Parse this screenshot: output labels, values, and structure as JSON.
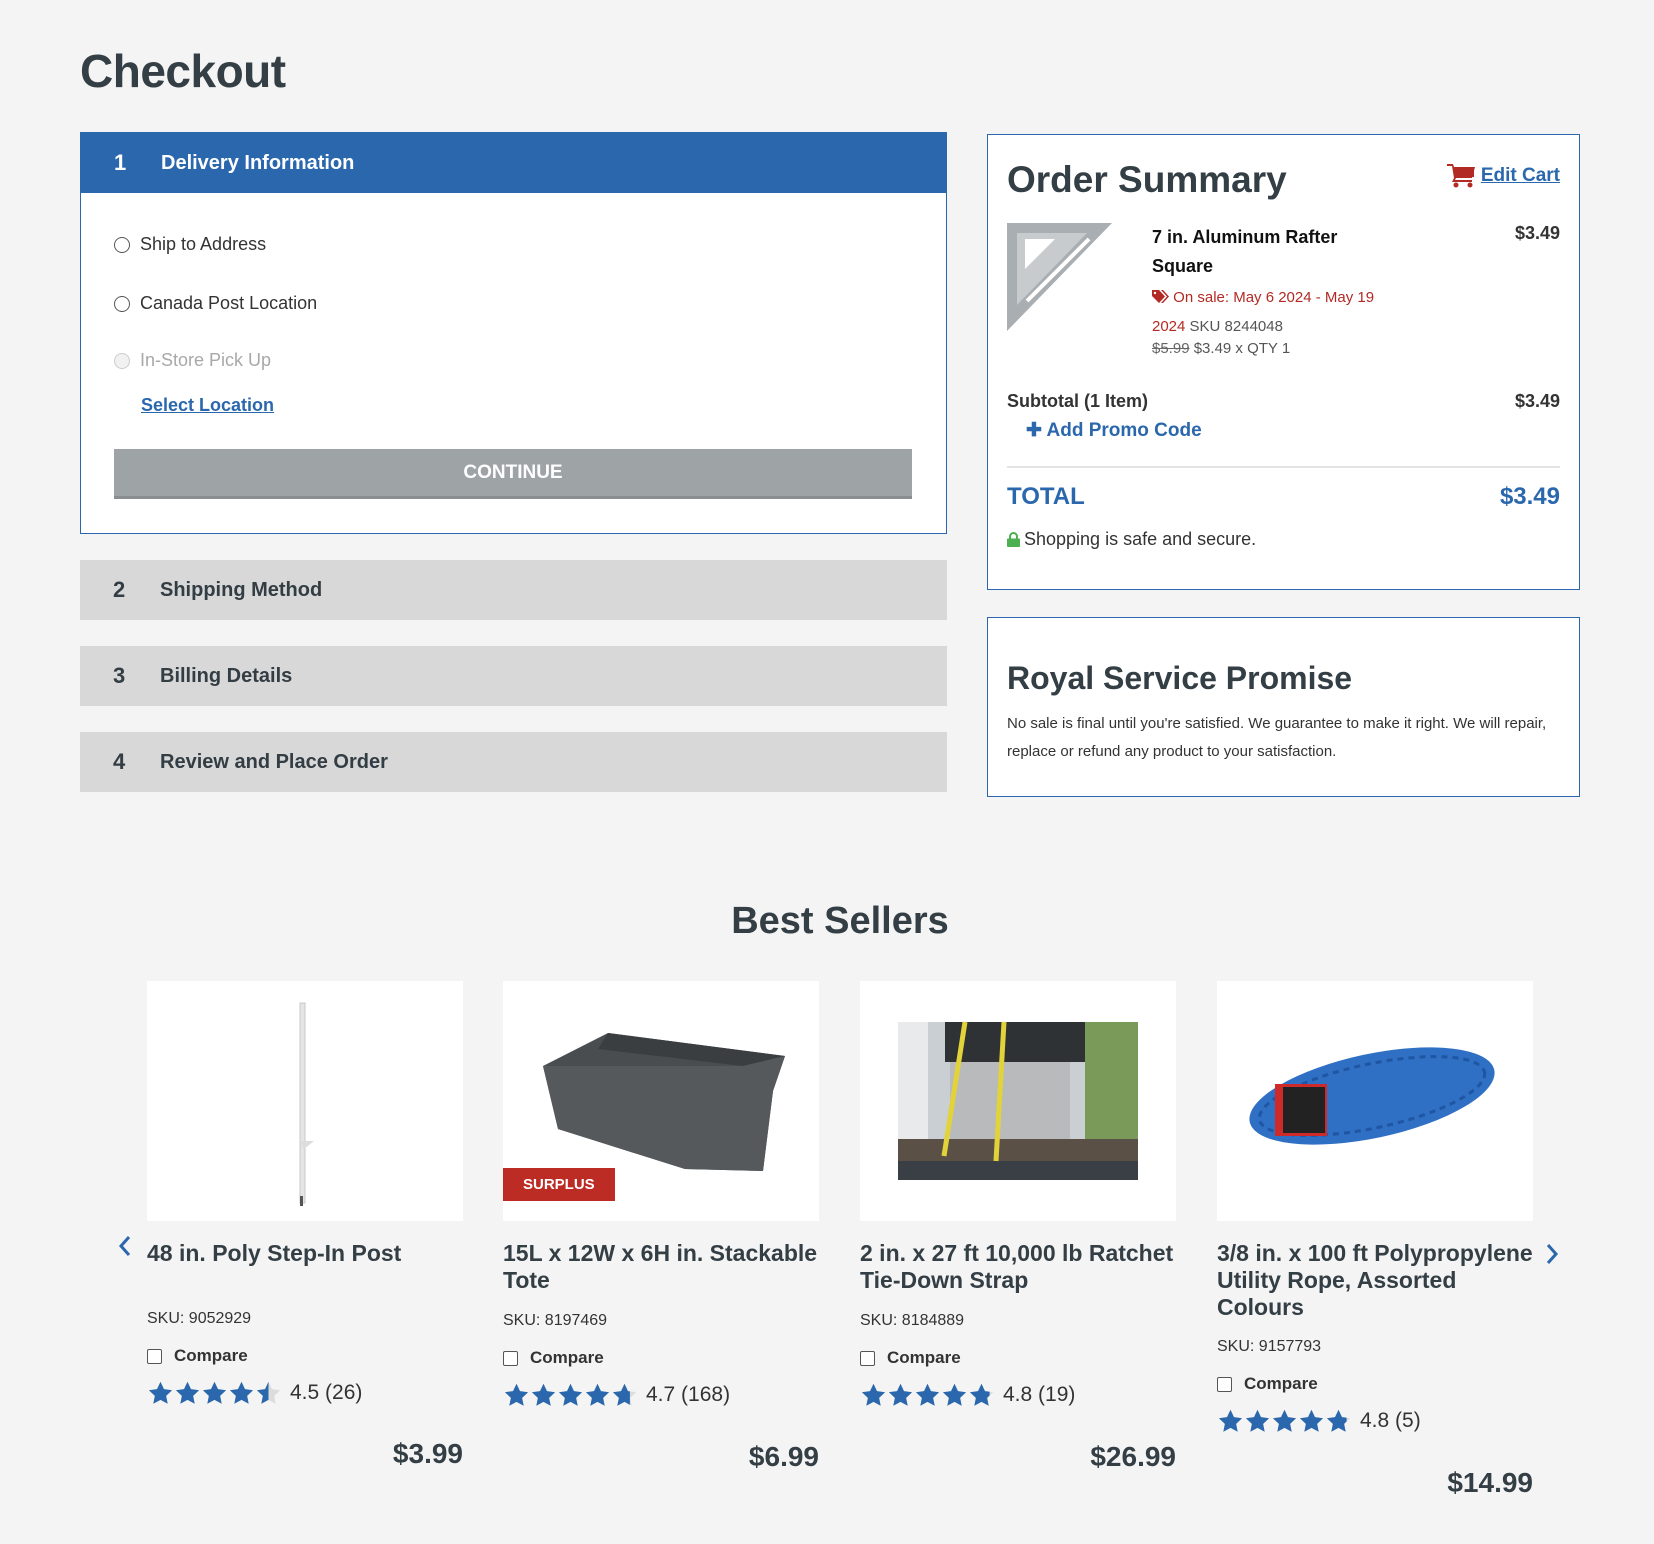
{
  "page": {
    "title": "Checkout"
  },
  "steps": [
    {
      "number": "1",
      "label": "Delivery Information",
      "active": true
    },
    {
      "number": "2",
      "label": "Shipping Method"
    },
    {
      "number": "3",
      "label": "Billing Details"
    },
    {
      "number": "4",
      "label": "Review and Place Order"
    }
  ],
  "delivery": {
    "options": [
      {
        "label": "Ship to Address",
        "disabled": false
      },
      {
        "label": "Canada Post Location",
        "disabled": false
      },
      {
        "label": "In-Store Pick Up",
        "disabled": true
      }
    ],
    "select_location": "Select Location",
    "continue_label": "CONTINUE"
  },
  "order_summary": {
    "title": "Order Summary",
    "edit_cart": "Edit Cart",
    "item": {
      "name": "7 in. Aluminum Rafter Square",
      "price": "$3.49",
      "sale_text": "On sale: May 6 2024 - May 19 2024",
      "sku": "SKU 8244048",
      "original_price": "$5.99",
      "qty_text": "$3.49 x QTY 1"
    },
    "subtotal_label": "Subtotal (1 Item)",
    "subtotal_value": "$3.49",
    "promo_label": "Add Promo Code",
    "total_label": "TOTAL",
    "total_value": "$3.49",
    "secure_text": "Shopping is safe and secure."
  },
  "promise": {
    "title": "Royal Service Promise",
    "text": "No sale is final until you're satisfied. We guarantee to make it right. We will repair, replace or refund any product to your satisfaction."
  },
  "best_sellers": {
    "title": "Best Sellers",
    "compare_label": "Compare",
    "products": [
      {
        "title": "48 in. Poly Step-In Post",
        "sku": "SKU: 9052929",
        "rating": 4.5,
        "rating_text": "4.5",
        "reviews": "(26)",
        "price": "$3.99",
        "badge": null
      },
      {
        "title": "15L x 12W x 6H in. Stackable Tote",
        "sku": "SKU: 8197469",
        "rating": 4.7,
        "rating_text": "4.7",
        "reviews": "(168)",
        "price": "$6.99",
        "badge": "SURPLUS"
      },
      {
        "title": "2 in. x 27 ft 10,000 lb Ratchet Tie-Down Strap",
        "sku": "SKU: 8184889",
        "rating": 4.8,
        "rating_text": "4.8",
        "reviews": "(19)",
        "price": "$26.99",
        "badge": null
      },
      {
        "title": "3/8 in. x 100 ft Polypropylene Utility Rope, Assorted Colours",
        "sku": "SKU: 9157793",
        "rating": 4.8,
        "rating_text": "4.8",
        "reviews": "(5)",
        "price": "$14.99",
        "badge": null
      }
    ]
  },
  "colors": {
    "primary": "#2a67ad",
    "sale": "#b22a24",
    "secure": "#4caf50"
  }
}
